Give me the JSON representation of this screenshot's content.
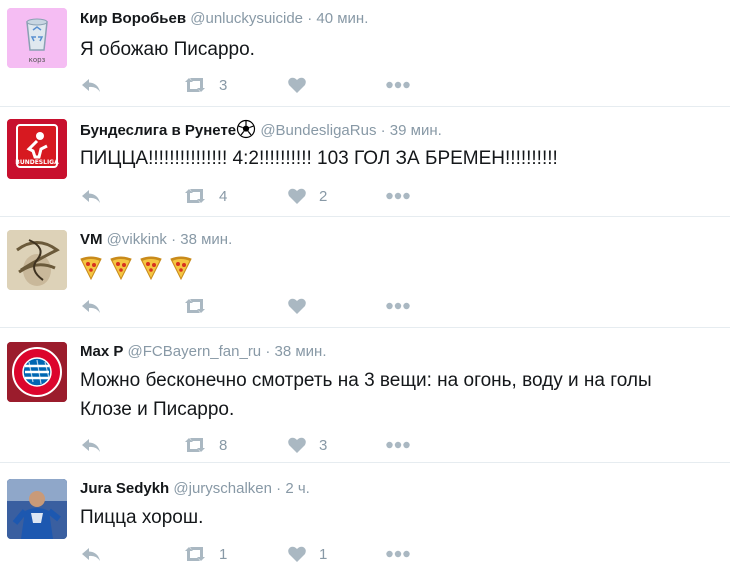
{
  "tweets": [
    {
      "name": "Кир Воробьев",
      "handle": "@unluckysuicide",
      "time": "40 мин.",
      "text": "Я обожаю Писарро.",
      "retweets": "3",
      "likes": "",
      "avatar": "recycle-bin",
      "avatar_text": "корз"
    },
    {
      "name": "Бундеслига в Рунете",
      "emoji": "soccer-ball-icon",
      "handle": "@BundesligaRus",
      "time": "39 мин.",
      "text": "ПИЦЦА!!!!!!!!!!!!!!! 4:2!!!!!!!!!! 103 ГОЛ ЗА БРЕМЕН!!!!!!!!!!",
      "retweets": "4",
      "likes": "2",
      "avatar": "bundesliga-logo",
      "avatar_text": "BUNDESLIGA"
    },
    {
      "name": "VM",
      "handle": "@vikkink",
      "time": "38 мин.",
      "text": "",
      "pizza_count": 4,
      "retweets": "",
      "likes": "",
      "avatar": "monogram"
    },
    {
      "name": "Max P",
      "handle": "@FCBayern_fan_ru",
      "time": "38 мин.",
      "text": "Можно бесконечно смотреть на 3 вещи: на огонь, воду и на голы Клозе и Писарро.",
      "retweets": "8",
      "likes": "3",
      "avatar": "bayern-badge"
    },
    {
      "name": "Jura Sedykh",
      "handle": "@juryschalken",
      "time": "2 ч.",
      "text": "Пицца хорош.",
      "retweets": "1",
      "likes": "1",
      "avatar": "player-photo"
    }
  ],
  "colors": {
    "name": "#14171a",
    "meta": "#8899a6",
    "divider": "#e6ecf0"
  }
}
